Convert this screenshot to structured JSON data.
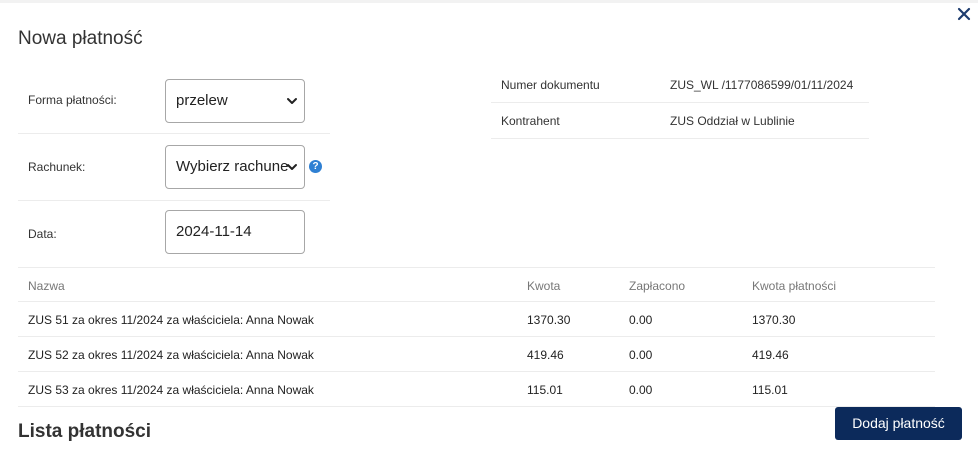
{
  "dialog": {
    "title": "Nowa płatność",
    "section_title": "Lista płatności",
    "add_button": "Dodaj płatność"
  },
  "form": {
    "payment_method_label": "Forma płatności:",
    "payment_method_value": "przelew",
    "account_label": "Rachunek:",
    "account_value": "Wybierz rachunek",
    "date_label": "Data:",
    "date_value": "2024-11-14",
    "help_glyph": "?"
  },
  "info": {
    "document_number_label": "Numer dokumentu",
    "document_number_value": "ZUS_WL /1177086599/01/11/2024",
    "contractor_label": "Kontrahent",
    "contractor_value": "ZUS Oddział w Lublinie"
  },
  "table": {
    "headers": [
      "Nazwa",
      "Kwota",
      "Zapłacono",
      "Kwota płatności"
    ],
    "rows": [
      [
        "ZUS 51 za okres 11/2024 za właściciela: Anna Nowak",
        "1370.30",
        "0.00",
        "1370.30"
      ],
      [
        "ZUS 52 za okres 11/2024 za właściciela: Anna Nowak",
        "419.46",
        "0.00",
        "419.46"
      ],
      [
        "ZUS 53 za okres 11/2024 za właściciela: Anna Nowak",
        "115.01",
        "0.00",
        "115.01"
      ]
    ]
  },
  "icons": {
    "close": "close-icon",
    "chevron": "chevron-down-icon",
    "help": "help-icon"
  },
  "colors": {
    "primary_button": "#0c2a5b",
    "help_icon": "#2f80d3",
    "close_icon": "#1d3c6e"
  }
}
